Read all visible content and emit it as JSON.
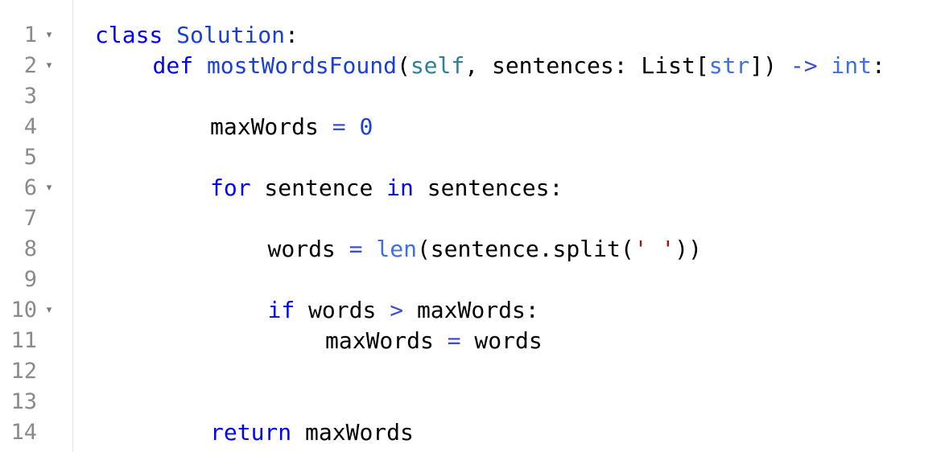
{
  "editor": {
    "lines": [
      {
        "number": "1",
        "fold": true,
        "indent": 0,
        "tokens": [
          {
            "t": "class",
            "k": "kw"
          },
          {
            "t": " ",
            "k": "plain"
          },
          {
            "t": "Solution",
            "k": "cls"
          },
          {
            "t": ":",
            "k": "plain"
          }
        ]
      },
      {
        "number": "2",
        "fold": true,
        "indent": 1,
        "tokens": [
          {
            "t": "def",
            "k": "kw"
          },
          {
            "t": " ",
            "k": "plain"
          },
          {
            "t": "mostWordsFound",
            "k": "fn"
          },
          {
            "t": "(",
            "k": "plain"
          },
          {
            "t": "self",
            "k": "self"
          },
          {
            "t": ", sentences: List[",
            "k": "plain"
          },
          {
            "t": "str",
            "k": "builtin"
          },
          {
            "t": "]) ",
            "k": "plain"
          },
          {
            "t": "->",
            "k": "op"
          },
          {
            "t": " ",
            "k": "plain"
          },
          {
            "t": "int",
            "k": "builtin"
          },
          {
            "t": ":",
            "k": "plain"
          }
        ]
      },
      {
        "number": "3",
        "fold": false,
        "indent": 0,
        "tokens": []
      },
      {
        "number": "4",
        "fold": false,
        "indent": 2,
        "tokens": [
          {
            "t": "maxWords ",
            "k": "plain"
          },
          {
            "t": "=",
            "k": "op"
          },
          {
            "t": " ",
            "k": "plain"
          },
          {
            "t": "0",
            "k": "num"
          }
        ]
      },
      {
        "number": "5",
        "fold": false,
        "indent": 0,
        "tokens": []
      },
      {
        "number": "6",
        "fold": true,
        "indent": 2,
        "tokens": [
          {
            "t": "for",
            "k": "kw"
          },
          {
            "t": " sentence ",
            "k": "plain"
          },
          {
            "t": "in",
            "k": "kw"
          },
          {
            "t": " sentences:",
            "k": "plain"
          }
        ]
      },
      {
        "number": "7",
        "fold": false,
        "indent": 0,
        "tokens": []
      },
      {
        "number": "8",
        "fold": false,
        "indent": 3,
        "tokens": [
          {
            "t": "words ",
            "k": "plain"
          },
          {
            "t": "=",
            "k": "op"
          },
          {
            "t": " ",
            "k": "plain"
          },
          {
            "t": "len",
            "k": "builtin"
          },
          {
            "t": "(sentence.split(",
            "k": "plain"
          },
          {
            "t": "' '",
            "k": "str"
          },
          {
            "t": "))",
            "k": "plain"
          }
        ]
      },
      {
        "number": "9",
        "fold": false,
        "indent": 0,
        "tokens": []
      },
      {
        "number": "10",
        "fold": true,
        "indent": 3,
        "tokens": [
          {
            "t": "if",
            "k": "kw"
          },
          {
            "t": " words ",
            "k": "plain"
          },
          {
            "t": ">",
            "k": "op"
          },
          {
            "t": " maxWords:",
            "k": "plain"
          }
        ]
      },
      {
        "number": "11",
        "fold": false,
        "indent": 4,
        "tokens": [
          {
            "t": "maxWords ",
            "k": "plain"
          },
          {
            "t": "=",
            "k": "op"
          },
          {
            "t": " words",
            "k": "plain"
          }
        ]
      },
      {
        "number": "12",
        "fold": false,
        "indent": 0,
        "tokens": []
      },
      {
        "number": "13",
        "fold": false,
        "indent": 0,
        "tokens": []
      },
      {
        "number": "14",
        "fold": false,
        "indent": 2,
        "tokens": [
          {
            "t": "return",
            "k": "kw"
          },
          {
            "t": " maxWords",
            "k": "plain"
          }
        ]
      }
    ],
    "fold_glyph": "▾"
  }
}
